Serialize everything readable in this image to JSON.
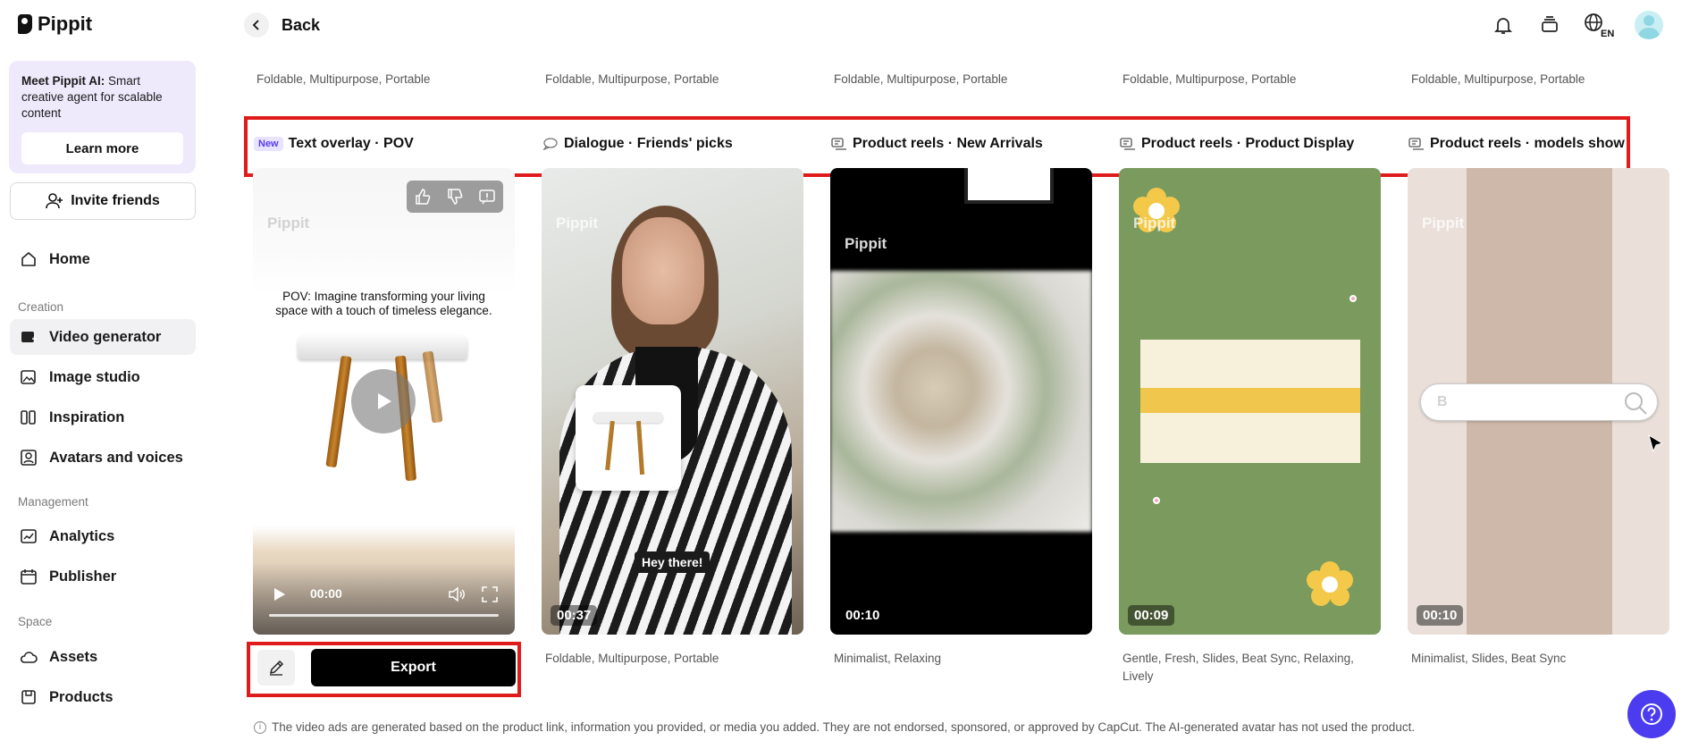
{
  "app": {
    "name": "Pippit"
  },
  "sidebar": {
    "promo": {
      "title": "Meet Pippit AI:",
      "text": " Smart creative agent for scalable content",
      "button": "Learn more"
    },
    "invite": "Invite friends",
    "home": "Home",
    "sections": {
      "creation": "Creation",
      "management": "Management",
      "space": "Space"
    },
    "items": {
      "video_generator": "Video generator",
      "image_studio": "Image studio",
      "inspiration": "Inspiration",
      "avatars": "Avatars and voices",
      "analytics": "Analytics",
      "publisher": "Publisher",
      "assets": "Assets",
      "products": "Products"
    }
  },
  "header": {
    "back": "Back",
    "lang": "EN"
  },
  "top_tags": [
    "Foldable, Multipurpose, Portable",
    "Foldable, Multipurpose, Portable",
    "Foldable, Multipurpose, Portable",
    "Foldable, Multipurpose, Portable",
    "Foldable, Multipurpose, Portable"
  ],
  "cards": [
    {
      "badge": "New",
      "title": "Text overlay · POV",
      "watermark": "Pippit",
      "overlay_text": "POV: Imagine transforming your living space with a touch of timeless elegance.",
      "time": "00:00"
    },
    {
      "title": "Dialogue · Friends' picks",
      "watermark": "Pippit",
      "duration": "00:37",
      "caption": "Hey there!",
      "tags": "Foldable, Multipurpose, Portable"
    },
    {
      "title": "Product reels · New Arrivals",
      "watermark": "Pippit",
      "duration": "00:10",
      "tags": "Minimalist, Relaxing"
    },
    {
      "title": "Product reels · Product Display",
      "watermark": "Pippit",
      "duration": "00:09",
      "tags": "Gentle, Fresh, Slides, Beat Sync, Relaxing, Lively"
    },
    {
      "title": "Product reels · models show",
      "watermark": "Pippit",
      "duration": "00:10",
      "search_letter": "B",
      "tags": "Minimalist, Slides, Beat Sync"
    }
  ],
  "actions": {
    "export": "Export"
  },
  "disclaimer": "The video ads are generated based on the product link, information you provided, or media you added. They are not endorsed, sponsored, or approved by CapCut. The AI-generated avatar has not used the product.",
  "colors": {
    "accent": "#4b3cf0",
    "highlight": "#e01b1b",
    "export": "#000000"
  }
}
